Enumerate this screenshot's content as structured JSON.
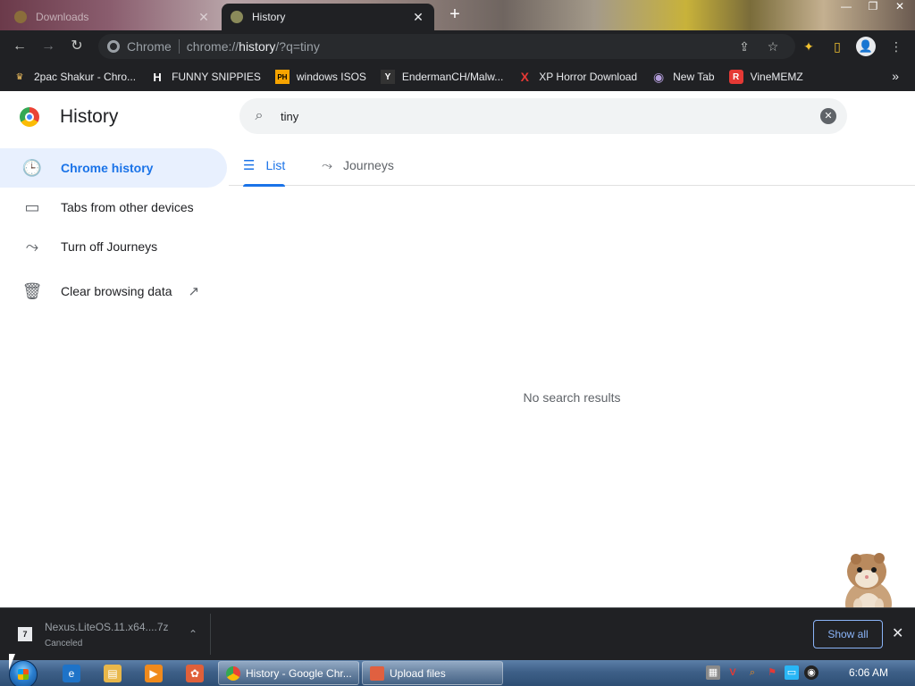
{
  "tabs": [
    {
      "title": "Downloads",
      "close": "✕",
      "active": false
    },
    {
      "title": "History",
      "close": "✕",
      "active": true
    }
  ],
  "window": {
    "new_tab": "+",
    "minimize": "—",
    "restore": "❐",
    "close": "✕"
  },
  "toolbar": {
    "back": "←",
    "forward": "→",
    "reload": "↻",
    "site_label": "Chrome",
    "url_scheme": "chrome://",
    "url_host": "history",
    "url_rest": "/?q=tiny",
    "share": "⇪",
    "star": "☆",
    "extension": "✦",
    "sidepanel": "▯",
    "profile": "👤",
    "menu": "⋮"
  },
  "bookmarks": [
    {
      "label": "2pac Shakur - Chro...",
      "icon": "♛",
      "color": "#f0c060"
    },
    {
      "label": "FUNNY SNIPPIES",
      "icon": "H",
      "color": "#ffffff"
    },
    {
      "label": "windows ISOS",
      "icon": "PH",
      "color": "#f7a400"
    },
    {
      "label": "EndermanCH/Malw...",
      "icon": "Y",
      "color": "#ffffff"
    },
    {
      "label": "XP Horror Download",
      "icon": "X",
      "color": "#e53935"
    },
    {
      "label": "New Tab",
      "icon": "◉",
      "color": "#b39ddb"
    },
    {
      "label": "VineMEMZ",
      "icon": "R",
      "color": "#e53935"
    }
  ],
  "bookmarks_more": "»",
  "history": {
    "title": "History",
    "search_value": "tiny",
    "search_icon": "⌕",
    "clear_icon": "✕",
    "sidebar": [
      {
        "label": "Chrome history",
        "icon": "🕒",
        "active": true
      },
      {
        "label": "Tabs from other devices",
        "icon": "▭",
        "active": false
      },
      {
        "label": "Turn off Journeys",
        "icon": "⤳",
        "active": false
      },
      {
        "label": "Clear browsing data",
        "icon": "🗑",
        "active": false,
        "external": "↗"
      }
    ],
    "tabs": [
      {
        "label": "List",
        "icon": "☰",
        "active": true
      },
      {
        "label": "Journeys",
        "icon": "⤳",
        "active": false
      }
    ],
    "empty_message": "No search results"
  },
  "download": {
    "filename": "Nexus.LiteOS.11.x64....7z",
    "status": "Canceled",
    "icon": "7",
    "chevron": "⌃",
    "show_all": "Show all",
    "close": "✕"
  },
  "taskbar": {
    "buttons": [
      {
        "label": "History - Google Chr...",
        "icon_color": "#4285f4"
      },
      {
        "label": "Upload files",
        "icon_color": "#e06040"
      }
    ],
    "clock": "6:06 AM"
  }
}
